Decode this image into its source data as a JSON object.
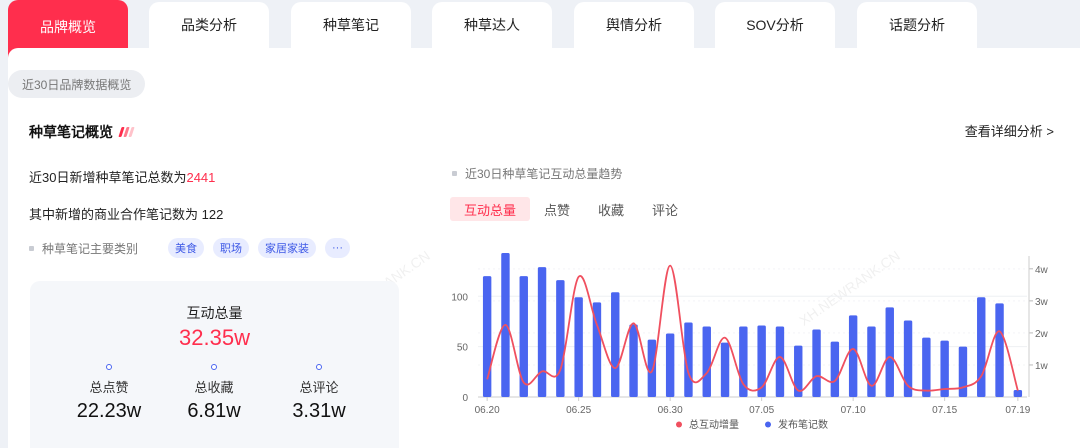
{
  "tabs": [
    "品牌概览",
    "品类分析",
    "种草笔记",
    "种草达人",
    "舆情分析",
    "SOV分析",
    "话题分析"
  ],
  "active_tab": 0,
  "period_pill": "近30日品牌数据概览",
  "section": {
    "title": "种草笔记概览",
    "detail_link": "查看详细分析 >",
    "line1_prefix": "近30日新增种草笔记总数为",
    "line1_value": "2441",
    "line2": "其中新增的商业合作笔记数为 122",
    "categories_label": "种草笔记主要类别",
    "categories": [
      "美食",
      "职场",
      "家居家装",
      "···"
    ]
  },
  "stats": {
    "total_label": "互动总量",
    "total_value": "32.35w",
    "likes_label": "总点赞",
    "likes_value": "22.23w",
    "collects_label": "总收藏",
    "collects_value": "6.81w",
    "comments_label": "总评论",
    "comments_value": "3.31w"
  },
  "chart_panel": {
    "title": "近30日种草笔记互动总量趋势",
    "metric_tabs": [
      "互动总量",
      "点赞",
      "收藏",
      "评论"
    ],
    "active_metric": 0
  },
  "watermark": "XH.NEWRANK.CN",
  "colors": {
    "brand_red": "#ff2e4d",
    "bar_blue": "#4a65f0",
    "line_red": "#f0505f"
  },
  "chart_data": {
    "type": "bar",
    "categories": [
      "06.20",
      "06.21",
      "06.22",
      "06.23",
      "06.24",
      "06.25",
      "06.26",
      "06.27",
      "06.28",
      "06.29",
      "06.30",
      "07.01",
      "07.02",
      "07.03",
      "07.04",
      "07.05",
      "07.06",
      "07.07",
      "07.08",
      "07.09",
      "07.10",
      "07.11",
      "07.12",
      "07.13",
      "07.14",
      "07.15",
      "07.16",
      "07.17",
      "07.18",
      "07.19"
    ],
    "x_tick_labels": [
      "06.20",
      "06.25",
      "06.30",
      "07.05",
      "07.10",
      "07.15",
      "07.19"
    ],
    "left_axis": {
      "ticks": [
        "0",
        "50",
        "100"
      ],
      "range": [
        0,
        140
      ]
    },
    "right_axis": {
      "ticks": [
        "1w",
        "2w",
        "3w",
        "4w"
      ],
      "range": [
        0,
        4.4
      ]
    },
    "series": [
      {
        "name": "发布笔记数",
        "kind": "bar",
        "axis": "left",
        "values": [
          120,
          143,
          120,
          129,
          116,
          99,
          94,
          104,
          72,
          57,
          63,
          74,
          70,
          54,
          70,
          71,
          70,
          51,
          67,
          55,
          81,
          70,
          89,
          76,
          59,
          56,
          50,
          99,
          93,
          7
        ]
      },
      {
        "name": "总互动增量",
        "kind": "line",
        "axis": "right",
        "values": [
          0.55,
          2.25,
          0.45,
          0.8,
          0.85,
          3.75,
          2.25,
          0.9,
          2.3,
          0.8,
          4.1,
          0.75,
          0.75,
          1.85,
          0.4,
          0.3,
          1.25,
          0.2,
          0.65,
          0.5,
          1.5,
          0.35,
          1.25,
          0.35,
          0.2,
          0.25,
          0.3,
          0.65,
          2.05,
          0.2
        ]
      }
    ]
  }
}
